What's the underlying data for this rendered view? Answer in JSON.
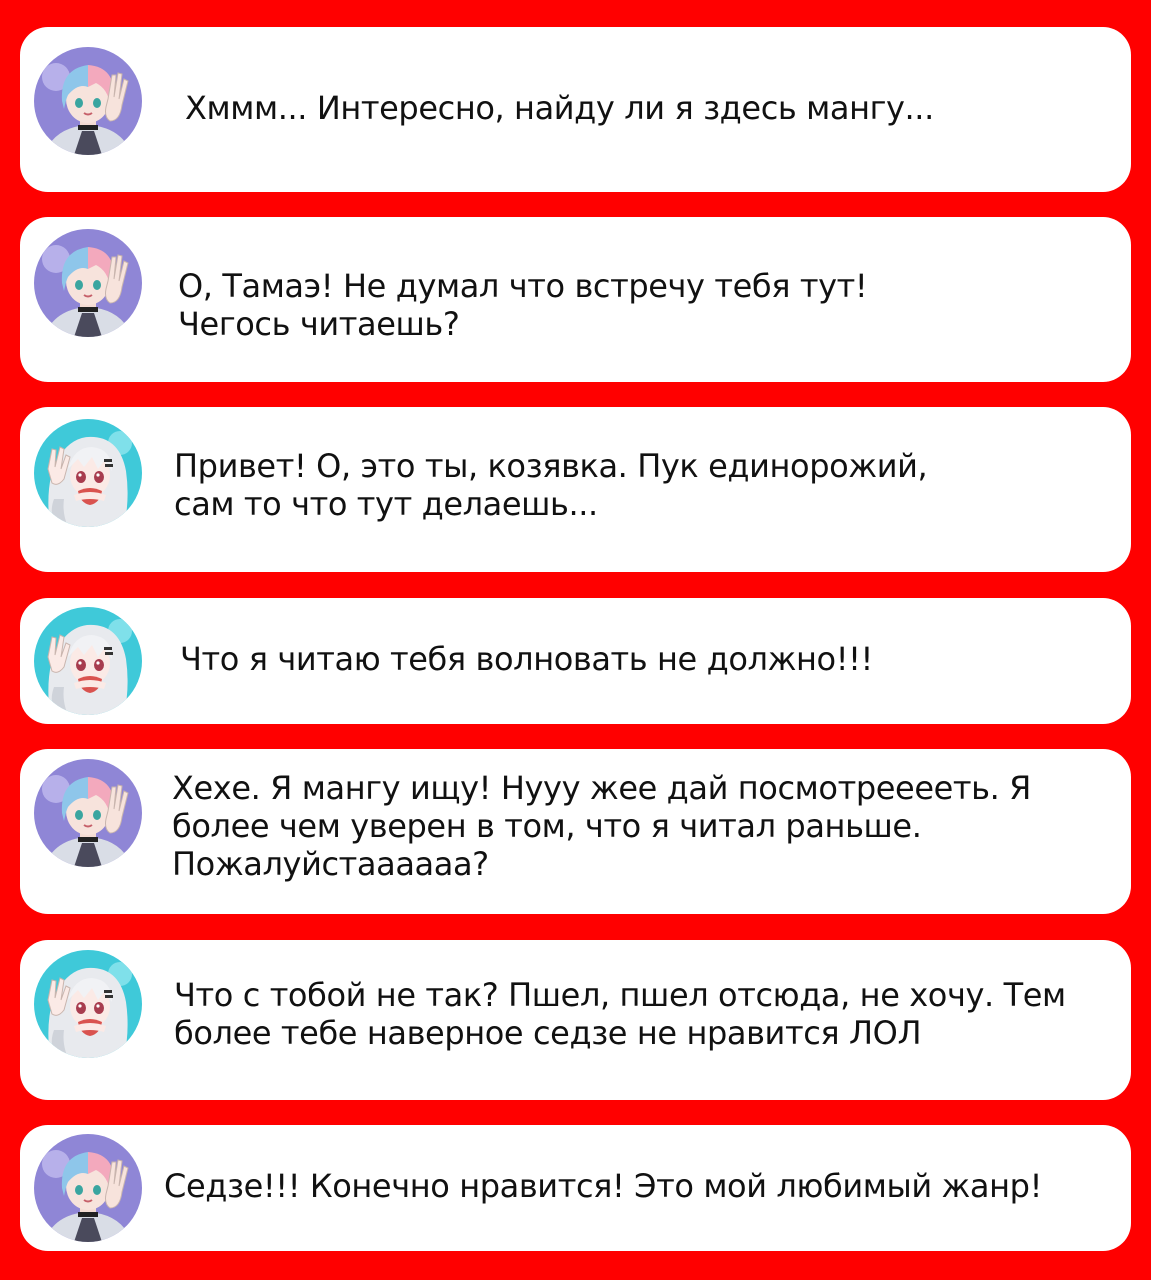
{
  "colors": {
    "background": "#ff0000",
    "bubble": "#ffffff",
    "text": "#111111",
    "avatar_boy_bg": "#8f86d6",
    "avatar_girl_bg": "#3fc9d9"
  },
  "messages": [
    {
      "avatar": "boy-avatar-icon",
      "lines": [
        "Хммм... Интересно, найду ли я здесь мангу..."
      ]
    },
    {
      "avatar": "boy-avatar-icon",
      "lines": [
        "О, Тамаэ! Не думал что встречу тебя тут!",
        "Чегось читаешь?"
      ]
    },
    {
      "avatar": "girl-avatar-icon",
      "lines": [
        "Привет! О, это ты, козявка. Пук единорожий,",
        "сам то что тут делаешь..."
      ]
    },
    {
      "avatar": "girl-avatar-icon",
      "lines": [
        "Что я читаю тебя волновать не должно!!!"
      ]
    },
    {
      "avatar": "boy-avatar-icon",
      "lines": [
        "Хехе. Я мангу ищу! Нууу жее дай посмотрееееть. Я",
        "более чем уверен в том, что я читал раньше.",
        "Пожалуйстаааааа?"
      ]
    },
    {
      "avatar": "girl-avatar-icon",
      "lines": [
        "Что с тобой не так? Пшел, пшел отсюда, не хочу. Тем",
        "более тебе наверное седзе не нравится ЛОЛ"
      ]
    },
    {
      "avatar": "boy-avatar-icon",
      "lines": [
        "Седзе!!! Конечно нравится! Это мой любимый жанр!"
      ]
    }
  ]
}
